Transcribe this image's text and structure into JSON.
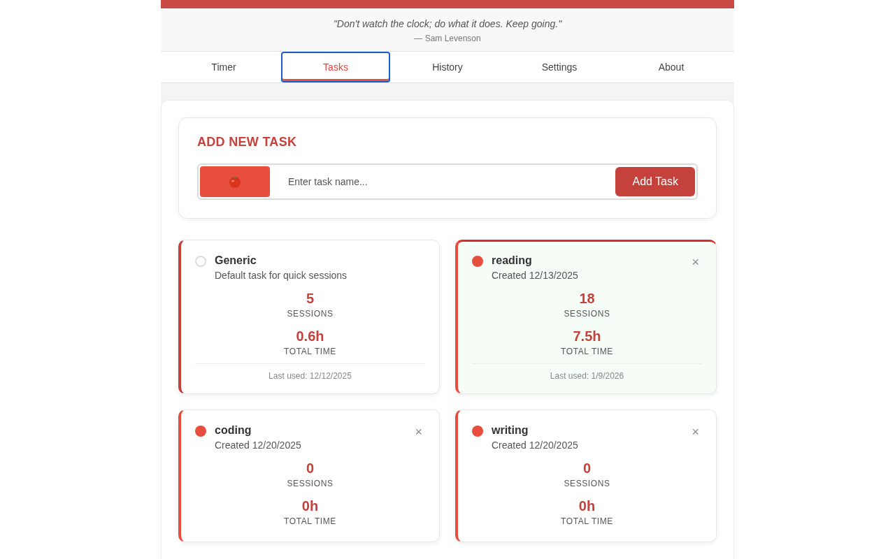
{
  "quote": {
    "text": "\"Don't watch the clock; do what it does. Keep going.\"",
    "author": "— Sam Levenson"
  },
  "tabs": [
    {
      "label": "Timer",
      "selected": false
    },
    {
      "label": "Tasks",
      "selected": true
    },
    {
      "label": "History",
      "selected": false
    },
    {
      "label": "Settings",
      "selected": false
    },
    {
      "label": "About",
      "selected": false
    }
  ],
  "add_task": {
    "title": "ADD NEW TASK",
    "placeholder": "Enter task name...",
    "button": "Add Task"
  },
  "tasks": [
    {
      "kind": "default",
      "name": "Generic",
      "subtitle": "Default task for quick sessions",
      "sessions": "5",
      "sessions_label": "SESSIONS",
      "time": "0.6h",
      "time_label": "TOTAL TIME",
      "last_used": "Last used: 12/12/2025",
      "selected": false
    },
    {
      "kind": "custom",
      "name": "reading",
      "subtitle": "Created 12/13/2025",
      "sessions": "18",
      "sessions_label": "SESSIONS",
      "time": "7.5h",
      "time_label": "TOTAL TIME",
      "last_used": "Last used: 1/9/2026",
      "selected": true,
      "close": "×"
    },
    {
      "kind": "custom",
      "name": "coding",
      "subtitle": "Created 12/20/2025",
      "sessions": "0",
      "sessions_label": "SESSIONS",
      "time": "0h",
      "time_label": "TOTAL TIME",
      "selected": false,
      "close": "×"
    },
    {
      "kind": "custom",
      "name": "writing",
      "subtitle": "Created 12/20/2025",
      "sessions": "0",
      "sessions_label": "SESSIONS",
      "time": "0h",
      "time_label": "TOTAL TIME",
      "selected": false,
      "close": "×"
    }
  ]
}
